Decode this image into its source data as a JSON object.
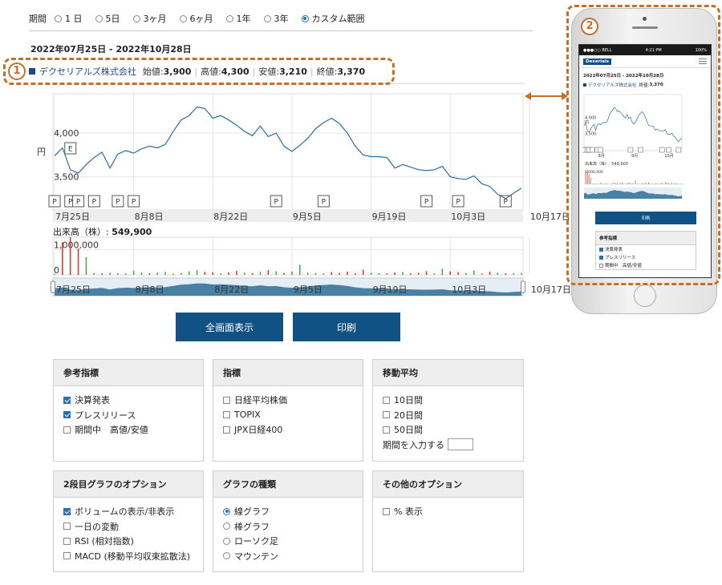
{
  "period": {
    "label": "期間",
    "options": [
      {
        "label": "1 日",
        "selected": false
      },
      {
        "label": "5日",
        "selected": false
      },
      {
        "label": "3ヶ月",
        "selected": false
      },
      {
        "label": "6ヶ月",
        "selected": false
      },
      {
        "label": "1年",
        "selected": false
      },
      {
        "label": "3年",
        "selected": false
      },
      {
        "label": "カスタム範囲",
        "selected": true
      }
    ]
  },
  "date_range": "2022年07月25日 - 2022年10月28日",
  "stock": {
    "company": "デクセリアルズ株式会社",
    "open_label": "始値:",
    "open": "3,900",
    "high_label": "高値:",
    "high": "4,300",
    "low_label": "安値:",
    "low": "3,210",
    "close_label": "終値:",
    "close": "3,370",
    "series_color": "#2c6e9e"
  },
  "chart_data": [
    {
      "type": "line",
      "ylabel": "円",
      "y_ticks": [
        "4,000",
        "3,500"
      ],
      "ylim": [
        3120,
        4450
      ],
      "x_ticks": [
        "7月25日",
        "8月8日",
        "8月22日",
        "9月5日",
        "9月19日",
        "10月3日",
        "10月17日"
      ],
      "x_tick_index": [
        0,
        10,
        20,
        30,
        40,
        50,
        60
      ],
      "events": [
        {
          "label": "E",
          "index": 2,
          "row": 0
        },
        {
          "label": "P",
          "index": 0,
          "row": 1
        },
        {
          "label": "P",
          "index": 2,
          "row": 1
        },
        {
          "label": "P",
          "index": 3,
          "row": 1
        },
        {
          "label": "P",
          "index": 5,
          "row": 1
        },
        {
          "label": "P",
          "index": 8,
          "row": 1
        },
        {
          "label": "P",
          "index": 10,
          "row": 1
        },
        {
          "label": "P",
          "index": 28,
          "row": 1
        },
        {
          "label": "P",
          "index": 34,
          "row": 1
        },
        {
          "label": "P",
          "index": 47,
          "row": 1
        },
        {
          "label": "P",
          "index": 51,
          "row": 1
        },
        {
          "label": "P",
          "index": 57,
          "row": 1
        }
      ],
      "series": [
        {
          "values": [
            3740,
            3830,
            3580,
            3540,
            3640,
            3720,
            3780,
            3600,
            3760,
            3800,
            3770,
            3820,
            3850,
            3830,
            3870,
            4020,
            4150,
            4200,
            4300,
            4280,
            4170,
            4200,
            4150,
            4090,
            4020,
            3970,
            4080,
            3960,
            4000,
            3850,
            3790,
            3860,
            3940,
            4050,
            4120,
            4170,
            4110,
            4000,
            3850,
            3750,
            3730,
            3730,
            3720,
            3600,
            3640,
            3610,
            3580,
            3570,
            3580,
            3620,
            3500,
            3480,
            3470,
            3510,
            3420,
            3390,
            3300,
            3250,
            3310,
            3370
          ]
        }
      ]
    },
    {
      "type": "bar",
      "title": "出来高（株）:",
      "value_label": "549,900",
      "y_ticks": [
        "1,000,000",
        "0"
      ],
      "ylim": [
        0,
        1500000
      ],
      "up_color": "#4caf50",
      "down_color": "#e53935",
      "values": [
        40000,
        1300000,
        1500000,
        1050000,
        700000,
        80000,
        60000,
        90000,
        70000,
        50000,
        170000,
        100000,
        60000,
        90000,
        120000,
        50000,
        70000,
        140000,
        200000,
        120000,
        110000,
        60000,
        100000,
        160000,
        90000,
        70000,
        120000,
        190000,
        150000,
        80000,
        130000,
        400000,
        90000,
        70000,
        60000,
        110000,
        80000,
        130000,
        60000,
        210000,
        90000,
        70000,
        60000,
        100000,
        120000,
        60000,
        80000,
        150000,
        60000,
        250000,
        140000,
        110000,
        80000,
        180000,
        60000,
        130000,
        90000,
        60000,
        70000,
        80000
      ],
      "up": [
        true,
        false,
        false,
        false,
        true,
        true,
        false,
        true,
        true,
        false,
        true,
        true,
        false,
        true,
        true,
        true,
        true,
        true,
        true,
        false,
        false,
        true,
        false,
        false,
        true,
        false,
        true,
        false,
        true,
        false,
        true,
        true,
        true,
        true,
        true,
        false,
        false,
        false,
        false,
        false,
        true,
        true,
        false,
        false,
        true,
        false,
        false,
        false,
        true,
        true,
        false,
        false,
        true,
        true,
        true,
        false,
        true,
        false,
        true,
        true
      ]
    }
  ],
  "navigator": {
    "x_ticks": [
      "7月25日",
      "8月8日",
      "8月22日",
      "9月5日",
      "9月19日",
      "10月3日",
      "10月17日"
    ]
  },
  "buttons": {
    "fullscreen": "全画面表示",
    "print": "印刷"
  },
  "panels": {
    "reference": {
      "title": "参考指標",
      "items": [
        {
          "label": "決算発表",
          "checked": true
        },
        {
          "label": "プレスリリース",
          "checked": true
        },
        {
          "label": "期間中　高値/安値",
          "checked": false
        }
      ]
    },
    "indices": {
      "title": "指標",
      "items": [
        {
          "label": "日経平均株価",
          "checked": false
        },
        {
          "label": "TOPIX",
          "checked": false
        },
        {
          "label": "JPX日経400",
          "checked": false
        }
      ]
    },
    "moving_avg": {
      "title": "移動平均",
      "items": [
        {
          "label": "10日間",
          "checked": false
        },
        {
          "label": "20日間",
          "checked": false
        },
        {
          "label": "50日間",
          "checked": false
        }
      ],
      "period_input_label": "期間を入力する"
    },
    "second_graph": {
      "title": "2段目グラフのオプション",
      "items": [
        {
          "label": "ボリュームの表示/非表示",
          "checked": true
        },
        {
          "label": "一日の変動",
          "checked": false
        },
        {
          "label": "RSI (相対指数)",
          "checked": false
        },
        {
          "label": "MACD (移動平均収束拡散法)",
          "checked": false
        }
      ]
    },
    "graph_type": {
      "title": "グラフの種類",
      "items": [
        {
          "label": "線グラフ",
          "selected": true
        },
        {
          "label": "棒グラフ",
          "selected": false
        },
        {
          "label": "ローソク足",
          "selected": false
        },
        {
          "label": "マウンテン",
          "selected": false
        }
      ]
    },
    "other": {
      "title": "その他のオプション",
      "items": [
        {
          "label": "% 表示",
          "checked": false
        }
      ]
    }
  },
  "callouts": {
    "one": "1",
    "two": "2",
    "color": "#c5702a"
  },
  "phone": {
    "status_left": "●●●○○ BELL",
    "status_time": "4:21 PM",
    "status_right": "100%",
    "logo": "Dexerials",
    "date_range": "2022年07月25日 - 2022年10月28日",
    "company": "デクセリアルズ株式会社",
    "close_label": "終値:",
    "close": "3,370",
    "y_ticks": [
      "4,000",
      "3,500"
    ],
    "yunit": "円",
    "x_ticks": [
      "8月",
      "9月",
      "10月"
    ],
    "vol_label": "出来高（株）:",
    "vol_value": "549,900",
    "vol_tick": "1,000,000",
    "print": "印刷",
    "panel_title": "参考指標",
    "panel_items": [
      {
        "label": "決算発表",
        "checked": true
      },
      {
        "label": "プレスリリース",
        "checked": true
      },
      {
        "label": "期間中　高値/安値",
        "checked": false
      }
    ]
  }
}
